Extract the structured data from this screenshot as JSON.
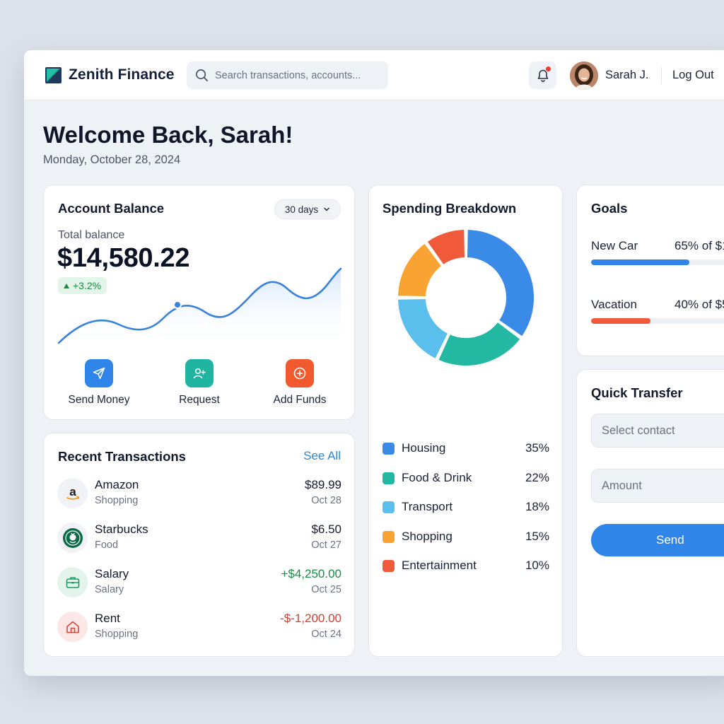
{
  "header": {
    "brand": "Zenith Finance",
    "search_placeholder": "Search transactions, accounts...",
    "user_name": "Sarah J.",
    "logout_label": "Log Out"
  },
  "welcome": {
    "title": "Welcome Back, Sarah!",
    "date": "Monday, October 28, 2024"
  },
  "balance": {
    "title": "Account Balance",
    "range": "30 days",
    "total_label": "Total balance",
    "amount": "$14,580.22",
    "change": "+3.2%",
    "actions": [
      {
        "label": "Send Money",
        "icon": "send-icon",
        "color": "#2f86e8"
      },
      {
        "label": "Request",
        "icon": "user-plus-icon",
        "color": "#1fb5a0"
      },
      {
        "label": "Add Funds",
        "icon": "plus-circle-icon",
        "color": "#f05a2e"
      }
    ]
  },
  "transactions": {
    "title": "Recent Transactions",
    "see_all": "See All",
    "items": [
      {
        "name": "Amazon",
        "category": "Shopping",
        "amount": "$89.99",
        "date": "Oct 28",
        "icon": "amazon-icon"
      },
      {
        "name": "Starbucks",
        "category": "Food",
        "amount": "$6.50",
        "date": "Oct 27",
        "icon": "starbucks-icon"
      },
      {
        "name": "Salary",
        "category": "Salary",
        "amount": "+$4,250.00",
        "date": "Oct 25",
        "icon": "briefcase-icon",
        "amount_color": "#1b8a44"
      },
      {
        "name": "Rent",
        "category": "Shopping",
        "amount": "-$-1,200.00",
        "date": "Oct 24",
        "icon": "home-icon",
        "amount_color": "#d93b30"
      }
    ]
  },
  "spending": {
    "title": "Spending Breakdown",
    "items": [
      {
        "name": "Housing",
        "pct": "35%",
        "value": 35,
        "color": "#3a8ae8"
      },
      {
        "name": "Food & Drink",
        "pct": "22%",
        "value": 22,
        "color": "#22b8a2"
      },
      {
        "name": "Transport",
        "pct": "18%",
        "value": 18,
        "color": "#5bbfee"
      },
      {
        "name": "Shopping",
        "pct": "15%",
        "value": 15,
        "color": "#f8a332"
      },
      {
        "name": "Entertainment",
        "pct": "10%",
        "value": 10,
        "color": "#f05a3a"
      }
    ]
  },
  "goals": {
    "title": "Goals",
    "items": [
      {
        "name": "New Car",
        "pct_label": "65% of $1",
        "progress": 0.58,
        "color": "#2f86e8"
      },
      {
        "name": "Vacation",
        "pct_label": "40% of $5",
        "progress": 0.35,
        "color": "#f05a3a"
      }
    ]
  },
  "quick_transfer": {
    "title": "Quick Transfer",
    "contact_placeholder": "Select contact",
    "amount_placeholder": "Amount",
    "send_label": "Send"
  }
}
